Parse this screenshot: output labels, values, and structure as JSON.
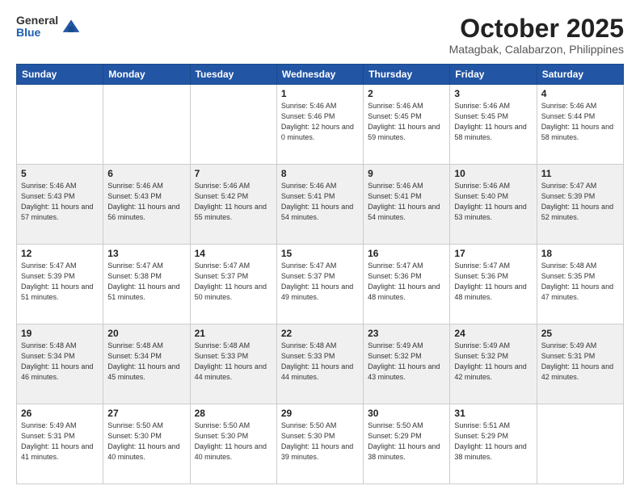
{
  "header": {
    "logo_general": "General",
    "logo_blue": "Blue",
    "month_title": "October 2025",
    "location": "Matagbak, Calabarzon, Philippines"
  },
  "weekdays": [
    "Sunday",
    "Monday",
    "Tuesday",
    "Wednesday",
    "Thursday",
    "Friday",
    "Saturday"
  ],
  "rows": [
    [
      {
        "day": "",
        "sunrise": "",
        "sunset": "",
        "daylight": ""
      },
      {
        "day": "",
        "sunrise": "",
        "sunset": "",
        "daylight": ""
      },
      {
        "day": "",
        "sunrise": "",
        "sunset": "",
        "daylight": ""
      },
      {
        "day": "1",
        "sunrise": "Sunrise: 5:46 AM",
        "sunset": "Sunset: 5:46 PM",
        "daylight": "Daylight: 12 hours and 0 minutes."
      },
      {
        "day": "2",
        "sunrise": "Sunrise: 5:46 AM",
        "sunset": "Sunset: 5:45 PM",
        "daylight": "Daylight: 11 hours and 59 minutes."
      },
      {
        "day": "3",
        "sunrise": "Sunrise: 5:46 AM",
        "sunset": "Sunset: 5:45 PM",
        "daylight": "Daylight: 11 hours and 58 minutes."
      },
      {
        "day": "4",
        "sunrise": "Sunrise: 5:46 AM",
        "sunset": "Sunset: 5:44 PM",
        "daylight": "Daylight: 11 hours and 58 minutes."
      }
    ],
    [
      {
        "day": "5",
        "sunrise": "Sunrise: 5:46 AM",
        "sunset": "Sunset: 5:43 PM",
        "daylight": "Daylight: 11 hours and 57 minutes."
      },
      {
        "day": "6",
        "sunrise": "Sunrise: 5:46 AM",
        "sunset": "Sunset: 5:43 PM",
        "daylight": "Daylight: 11 hours and 56 minutes."
      },
      {
        "day": "7",
        "sunrise": "Sunrise: 5:46 AM",
        "sunset": "Sunset: 5:42 PM",
        "daylight": "Daylight: 11 hours and 55 minutes."
      },
      {
        "day": "8",
        "sunrise": "Sunrise: 5:46 AM",
        "sunset": "Sunset: 5:41 PM",
        "daylight": "Daylight: 11 hours and 54 minutes."
      },
      {
        "day": "9",
        "sunrise": "Sunrise: 5:46 AM",
        "sunset": "Sunset: 5:41 PM",
        "daylight": "Daylight: 11 hours and 54 minutes."
      },
      {
        "day": "10",
        "sunrise": "Sunrise: 5:46 AM",
        "sunset": "Sunset: 5:40 PM",
        "daylight": "Daylight: 11 hours and 53 minutes."
      },
      {
        "day": "11",
        "sunrise": "Sunrise: 5:47 AM",
        "sunset": "Sunset: 5:39 PM",
        "daylight": "Daylight: 11 hours and 52 minutes."
      }
    ],
    [
      {
        "day": "12",
        "sunrise": "Sunrise: 5:47 AM",
        "sunset": "Sunset: 5:39 PM",
        "daylight": "Daylight: 11 hours and 51 minutes."
      },
      {
        "day": "13",
        "sunrise": "Sunrise: 5:47 AM",
        "sunset": "Sunset: 5:38 PM",
        "daylight": "Daylight: 11 hours and 51 minutes."
      },
      {
        "day": "14",
        "sunrise": "Sunrise: 5:47 AM",
        "sunset": "Sunset: 5:37 PM",
        "daylight": "Daylight: 11 hours and 50 minutes."
      },
      {
        "day": "15",
        "sunrise": "Sunrise: 5:47 AM",
        "sunset": "Sunset: 5:37 PM",
        "daylight": "Daylight: 11 hours and 49 minutes."
      },
      {
        "day": "16",
        "sunrise": "Sunrise: 5:47 AM",
        "sunset": "Sunset: 5:36 PM",
        "daylight": "Daylight: 11 hours and 48 minutes."
      },
      {
        "day": "17",
        "sunrise": "Sunrise: 5:47 AM",
        "sunset": "Sunset: 5:36 PM",
        "daylight": "Daylight: 11 hours and 48 minutes."
      },
      {
        "day": "18",
        "sunrise": "Sunrise: 5:48 AM",
        "sunset": "Sunset: 5:35 PM",
        "daylight": "Daylight: 11 hours and 47 minutes."
      }
    ],
    [
      {
        "day": "19",
        "sunrise": "Sunrise: 5:48 AM",
        "sunset": "Sunset: 5:34 PM",
        "daylight": "Daylight: 11 hours and 46 minutes."
      },
      {
        "day": "20",
        "sunrise": "Sunrise: 5:48 AM",
        "sunset": "Sunset: 5:34 PM",
        "daylight": "Daylight: 11 hours and 45 minutes."
      },
      {
        "day": "21",
        "sunrise": "Sunrise: 5:48 AM",
        "sunset": "Sunset: 5:33 PM",
        "daylight": "Daylight: 11 hours and 44 minutes."
      },
      {
        "day": "22",
        "sunrise": "Sunrise: 5:48 AM",
        "sunset": "Sunset: 5:33 PM",
        "daylight": "Daylight: 11 hours and 44 minutes."
      },
      {
        "day": "23",
        "sunrise": "Sunrise: 5:49 AM",
        "sunset": "Sunset: 5:32 PM",
        "daylight": "Daylight: 11 hours and 43 minutes."
      },
      {
        "day": "24",
        "sunrise": "Sunrise: 5:49 AM",
        "sunset": "Sunset: 5:32 PM",
        "daylight": "Daylight: 11 hours and 42 minutes."
      },
      {
        "day": "25",
        "sunrise": "Sunrise: 5:49 AM",
        "sunset": "Sunset: 5:31 PM",
        "daylight": "Daylight: 11 hours and 42 minutes."
      }
    ],
    [
      {
        "day": "26",
        "sunrise": "Sunrise: 5:49 AM",
        "sunset": "Sunset: 5:31 PM",
        "daylight": "Daylight: 11 hours and 41 minutes."
      },
      {
        "day": "27",
        "sunrise": "Sunrise: 5:50 AM",
        "sunset": "Sunset: 5:30 PM",
        "daylight": "Daylight: 11 hours and 40 minutes."
      },
      {
        "day": "28",
        "sunrise": "Sunrise: 5:50 AM",
        "sunset": "Sunset: 5:30 PM",
        "daylight": "Daylight: 11 hours and 40 minutes."
      },
      {
        "day": "29",
        "sunrise": "Sunrise: 5:50 AM",
        "sunset": "Sunset: 5:30 PM",
        "daylight": "Daylight: 11 hours and 39 minutes."
      },
      {
        "day": "30",
        "sunrise": "Sunrise: 5:50 AM",
        "sunset": "Sunset: 5:29 PM",
        "daylight": "Daylight: 11 hours and 38 minutes."
      },
      {
        "day": "31",
        "sunrise": "Sunrise: 5:51 AM",
        "sunset": "Sunset: 5:29 PM",
        "daylight": "Daylight: 11 hours and 38 minutes."
      },
      {
        "day": "",
        "sunrise": "",
        "sunset": "",
        "daylight": ""
      }
    ]
  ],
  "row_styles": [
    "white",
    "shaded",
    "white",
    "shaded",
    "white"
  ]
}
